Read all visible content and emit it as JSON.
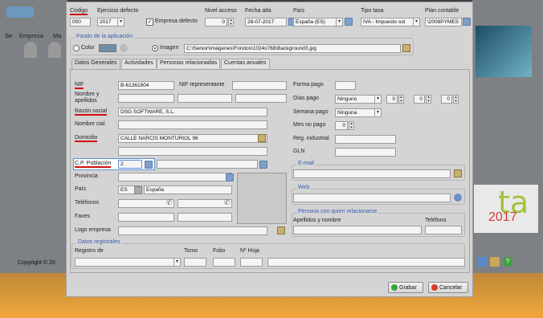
{
  "background_app": {
    "menu": [
      "Empresa",
      "Ma"
    ],
    "side_label": "Se",
    "copyright": "Copyright © 20",
    "logo_fragment": "ta",
    "logo_year": "2017"
  },
  "dialog": {
    "header": {
      "codigo_label": "Código",
      "codigo_value": "000",
      "ejercicio_label": "Ejercicio defecto",
      "ejercicio_value": "2017",
      "empresa_defecto_label": "Empresa defecto",
      "empresa_defecto_checked": true,
      "nivel_label": "Nivel acceso",
      "nivel_value": "0",
      "fecha_label": "Fecha alta",
      "fecha_value": "28-07-2017",
      "pais_label": "País",
      "pais_value": "España (ES)",
      "tasa_label": "Tipo tasa",
      "tasa_value": "IVA - Impuesto sol",
      "plan_label": "Plan contable",
      "plan_value": "\\2008PYMES"
    },
    "fondo": {
      "title": "Fondo de la aplicación",
      "color_label": "Color",
      "imagen_label": "Imagen",
      "selected": "Imagen",
      "path": "C:\\Senior\\Imágenes\\Fondos\\1024x768\\Background3.jpg"
    },
    "tabs": [
      "Datos Generales",
      "Actividades",
      "Personas relacionadas",
      "Cuentas anuales"
    ],
    "active_tab": "Datos Generales",
    "left": {
      "nif_label": "NIF",
      "nif_value": "B-61361804",
      "nif_rep_label": "NIF representante",
      "nif_rep_value": "",
      "nombre_label": "Nombre y apellidos",
      "razon_label": "Razón social",
      "razon_value": "DSG SOFTWARE, S.L.",
      "nombre_cial_label": "Nombre cial.",
      "domicilio_label": "Domicilio",
      "domicilio_value": "CALLE NARCÍS MONTURIOL 96",
      "cp_label": "C.P. Población",
      "cp_value": "2",
      "provincia_label": "Provincia",
      "pais_label": "País",
      "pais_code": "ES",
      "pais_name": "España",
      "telefonos_label": "Teléfonos",
      "faxes_label": "Faxes",
      "logo_label": "Logo empresa"
    },
    "right": {
      "forma_pago_label": "Forma pago",
      "dias_pago_label": "Días pago",
      "dias_pago_value": "Ninguno",
      "dias": [
        "0",
        "0",
        "0"
      ],
      "semana_pago_label": "Semana pago",
      "semana_pago_value": "Ninguna",
      "mes_no_pago_label": "Mes no pago",
      "mes_no_pago_value": "0",
      "reg_industrial_label": "Reg. industrial",
      "gln_label": "GLN",
      "email_title": "E-mail",
      "web_title": "Web",
      "persona_title": "Persona con quien relacionarse",
      "apellidos_label": "Apellidos y nombre",
      "telefono_label": "Teléfono"
    },
    "registrales": {
      "title": "Datos registrales",
      "registro_label": "Registro de",
      "tomo_label": "Tomo",
      "folio_label": "Folio",
      "hoja_label": "Nº Hoja"
    },
    "buttons": {
      "grabar": "Grabar",
      "cancelar": "Cancelar"
    }
  }
}
